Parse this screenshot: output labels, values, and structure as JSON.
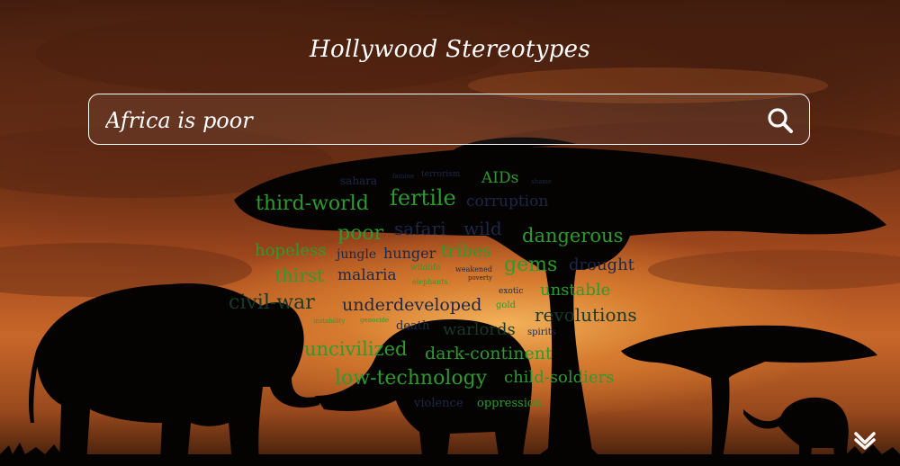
{
  "header": {
    "title": "Hollywood Stereotypes"
  },
  "search": {
    "value": "Africa is poor"
  },
  "icons": {
    "search": "search-icon",
    "scroll_down": "chevron-down-icon"
  },
  "colors": {
    "green": "#2e9a2e",
    "navy": "#1c2847",
    "dark_green": "#163a2a"
  },
  "word_cloud": [
    {
      "text": "sahara"
    },
    {
      "text": "famine"
    },
    {
      "text": "terrorism"
    },
    {
      "text": "AIDs"
    },
    {
      "text": "shame"
    },
    {
      "text": "third-world"
    },
    {
      "text": "fertile"
    },
    {
      "text": "corruption"
    },
    {
      "text": "poor"
    },
    {
      "text": "safari"
    },
    {
      "text": "wild"
    },
    {
      "text": "dangerous"
    },
    {
      "text": "hopeless"
    },
    {
      "text": "jungle"
    },
    {
      "text": "hunger"
    },
    {
      "text": "tribes"
    },
    {
      "text": "thirst"
    },
    {
      "text": "malaria"
    },
    {
      "text": "wildlife"
    },
    {
      "text": "weakened"
    },
    {
      "text": "gems"
    },
    {
      "text": "drought"
    },
    {
      "text": "elephants"
    },
    {
      "text": "poverty"
    },
    {
      "text": "exotic"
    },
    {
      "text": "unstable"
    },
    {
      "text": "civil-war"
    },
    {
      "text": "underdeveloped"
    },
    {
      "text": "gold"
    },
    {
      "text": "revolutions"
    },
    {
      "text": "instability"
    },
    {
      "text": "genocide"
    },
    {
      "text": "death"
    },
    {
      "text": "warlords"
    },
    {
      "text": "spirits"
    },
    {
      "text": "uncivilized"
    },
    {
      "text": "dark-continent"
    },
    {
      "text": "low-technology"
    },
    {
      "text": "child-soldiers"
    },
    {
      "text": "violence"
    },
    {
      "text": "oppression"
    }
  ]
}
